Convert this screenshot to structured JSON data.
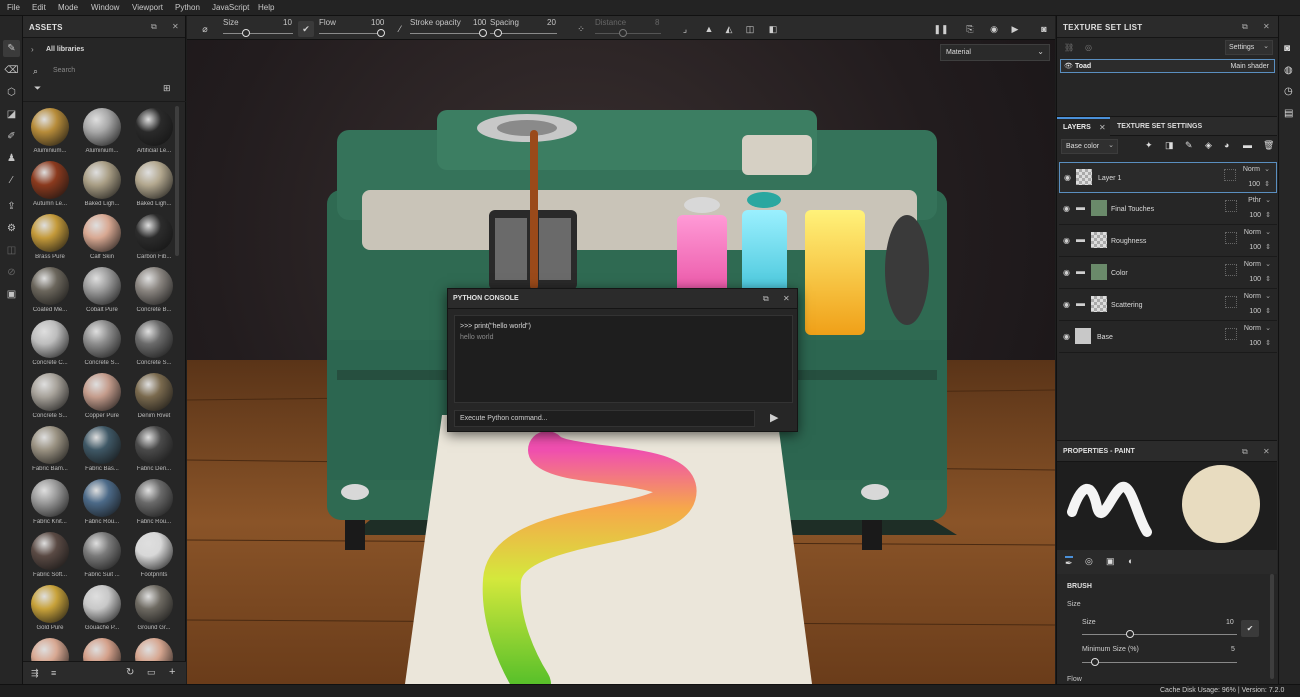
{
  "menu": [
    "File",
    "Edit",
    "Mode",
    "Window",
    "Viewport",
    "Python",
    "JavaScript",
    "Help"
  ],
  "assets": {
    "title": "ASSETS",
    "library": "All libraries",
    "search_placeholder": "Search",
    "items": [
      {
        "label": "Aluminium...",
        "color": "#b78c3a"
      },
      {
        "label": "Aluminium...",
        "color": "#a8a8a8"
      },
      {
        "label": "Artificial Le...",
        "color": "#2a2a2a"
      },
      {
        "label": "Autumn Le...",
        "color": "#8b3a1e"
      },
      {
        "label": "Baked Ligh...",
        "color": "#a99e85"
      },
      {
        "label": "Baked Ligh...",
        "color": "#b3a88f"
      },
      {
        "label": "Brass Pure",
        "color": "#c49a3a"
      },
      {
        "label": "Calf Skin",
        "color": "#d8a892"
      },
      {
        "label": "Carbon Fib...",
        "color": "#2c2c2c"
      },
      {
        "label": "Coated Me...",
        "color": "#6b665c"
      },
      {
        "label": "Cobalt Pure",
        "color": "#9c9c9c"
      },
      {
        "label": "Concrete B...",
        "color": "#8a8580"
      },
      {
        "label": "Concrete C...",
        "color": "#bdbdbd"
      },
      {
        "label": "Concrete S...",
        "color": "#8d8d8d"
      },
      {
        "label": "Concrete S...",
        "color": "#6b6b6b"
      },
      {
        "label": "Concrete S...",
        "color": "#a7a29a"
      },
      {
        "label": "Copper Pure",
        "color": "#c49c8c"
      },
      {
        "label": "Denim Rivet",
        "color": "#7a6a4e"
      },
      {
        "label": "Fabric Bam...",
        "color": "#9a9282"
      },
      {
        "label": "Fabric Bas...",
        "color": "#3f5866"
      },
      {
        "label": "Fabric Den...",
        "color": "#4a4a4a"
      },
      {
        "label": "Fabric Knit...",
        "color": "#9a9a9a"
      },
      {
        "label": "Fabric Rou...",
        "color": "#4c6a88"
      },
      {
        "label": "Fabric Rou...",
        "color": "#6a6a6a"
      },
      {
        "label": "Fabric Soft...",
        "color": "#5a4a44"
      },
      {
        "label": "Fabric Suit ...",
        "color": "#7a7a7a"
      },
      {
        "label": "Footprints",
        "color": "#d8d8d8"
      },
      {
        "label": "Gold Pure",
        "color": "#c8a23a"
      },
      {
        "label": "Gouache P...",
        "color": "#c8c8c8"
      },
      {
        "label": "Ground Gr...",
        "color": "#6e6a62"
      },
      {
        "label": "",
        "color": "#d8a892"
      },
      {
        "label": "",
        "color": "#d4a08a"
      },
      {
        "label": "",
        "color": "#d6a690"
      }
    ]
  },
  "toolbar": {
    "size_label": "Size",
    "size_value": "10",
    "flow_label": "Flow",
    "flow_value": "100",
    "stroke_label": "Stroke opacity",
    "stroke_value": "100",
    "spacing_label": "Spacing",
    "spacing_value": "20",
    "distance_label": "Distance",
    "distance_value": "8"
  },
  "viewport": {
    "mode": "Material"
  },
  "console": {
    "title": "PYTHON CONSOLE",
    "command": ">>> print(\"hello world\")",
    "output": "hello world",
    "input_placeholder": "Execute Python command..."
  },
  "texture_set": {
    "title": "TEXTURE SET LIST",
    "settings": "Settings",
    "item_name": "Toad",
    "item_shader": "Main shader"
  },
  "layers": {
    "tab_layers": "LAYERS",
    "tab_settings": "TEXTURE SET SETTINGS",
    "channel": "Base color",
    "items": [
      {
        "name": "Layer 1",
        "blend": "Norm",
        "opacity": "100",
        "folder": false
      },
      {
        "name": "Final Touches",
        "blend": "Pthr",
        "opacity": "100",
        "folder": true
      },
      {
        "name": "Roughness",
        "blend": "Norm",
        "opacity": "100",
        "folder": true
      },
      {
        "name": "Color",
        "blend": "Norm",
        "opacity": "100",
        "folder": true
      },
      {
        "name": "Scattering",
        "blend": "Norm",
        "opacity": "100",
        "folder": true
      },
      {
        "name": "Base",
        "blend": "Norm",
        "opacity": "100",
        "folder": false
      }
    ]
  },
  "properties": {
    "title": "PROPERTIES - PAINT",
    "section": "BRUSH",
    "size_group": "Size",
    "size_label": "Size",
    "size_value": "10",
    "min_size_label": "Minimum Size (%)",
    "min_size_value": "5",
    "flow_label": "Flow"
  },
  "status": {
    "text": "Cache Disk Usage: 96% | Version: 7.2.0"
  }
}
